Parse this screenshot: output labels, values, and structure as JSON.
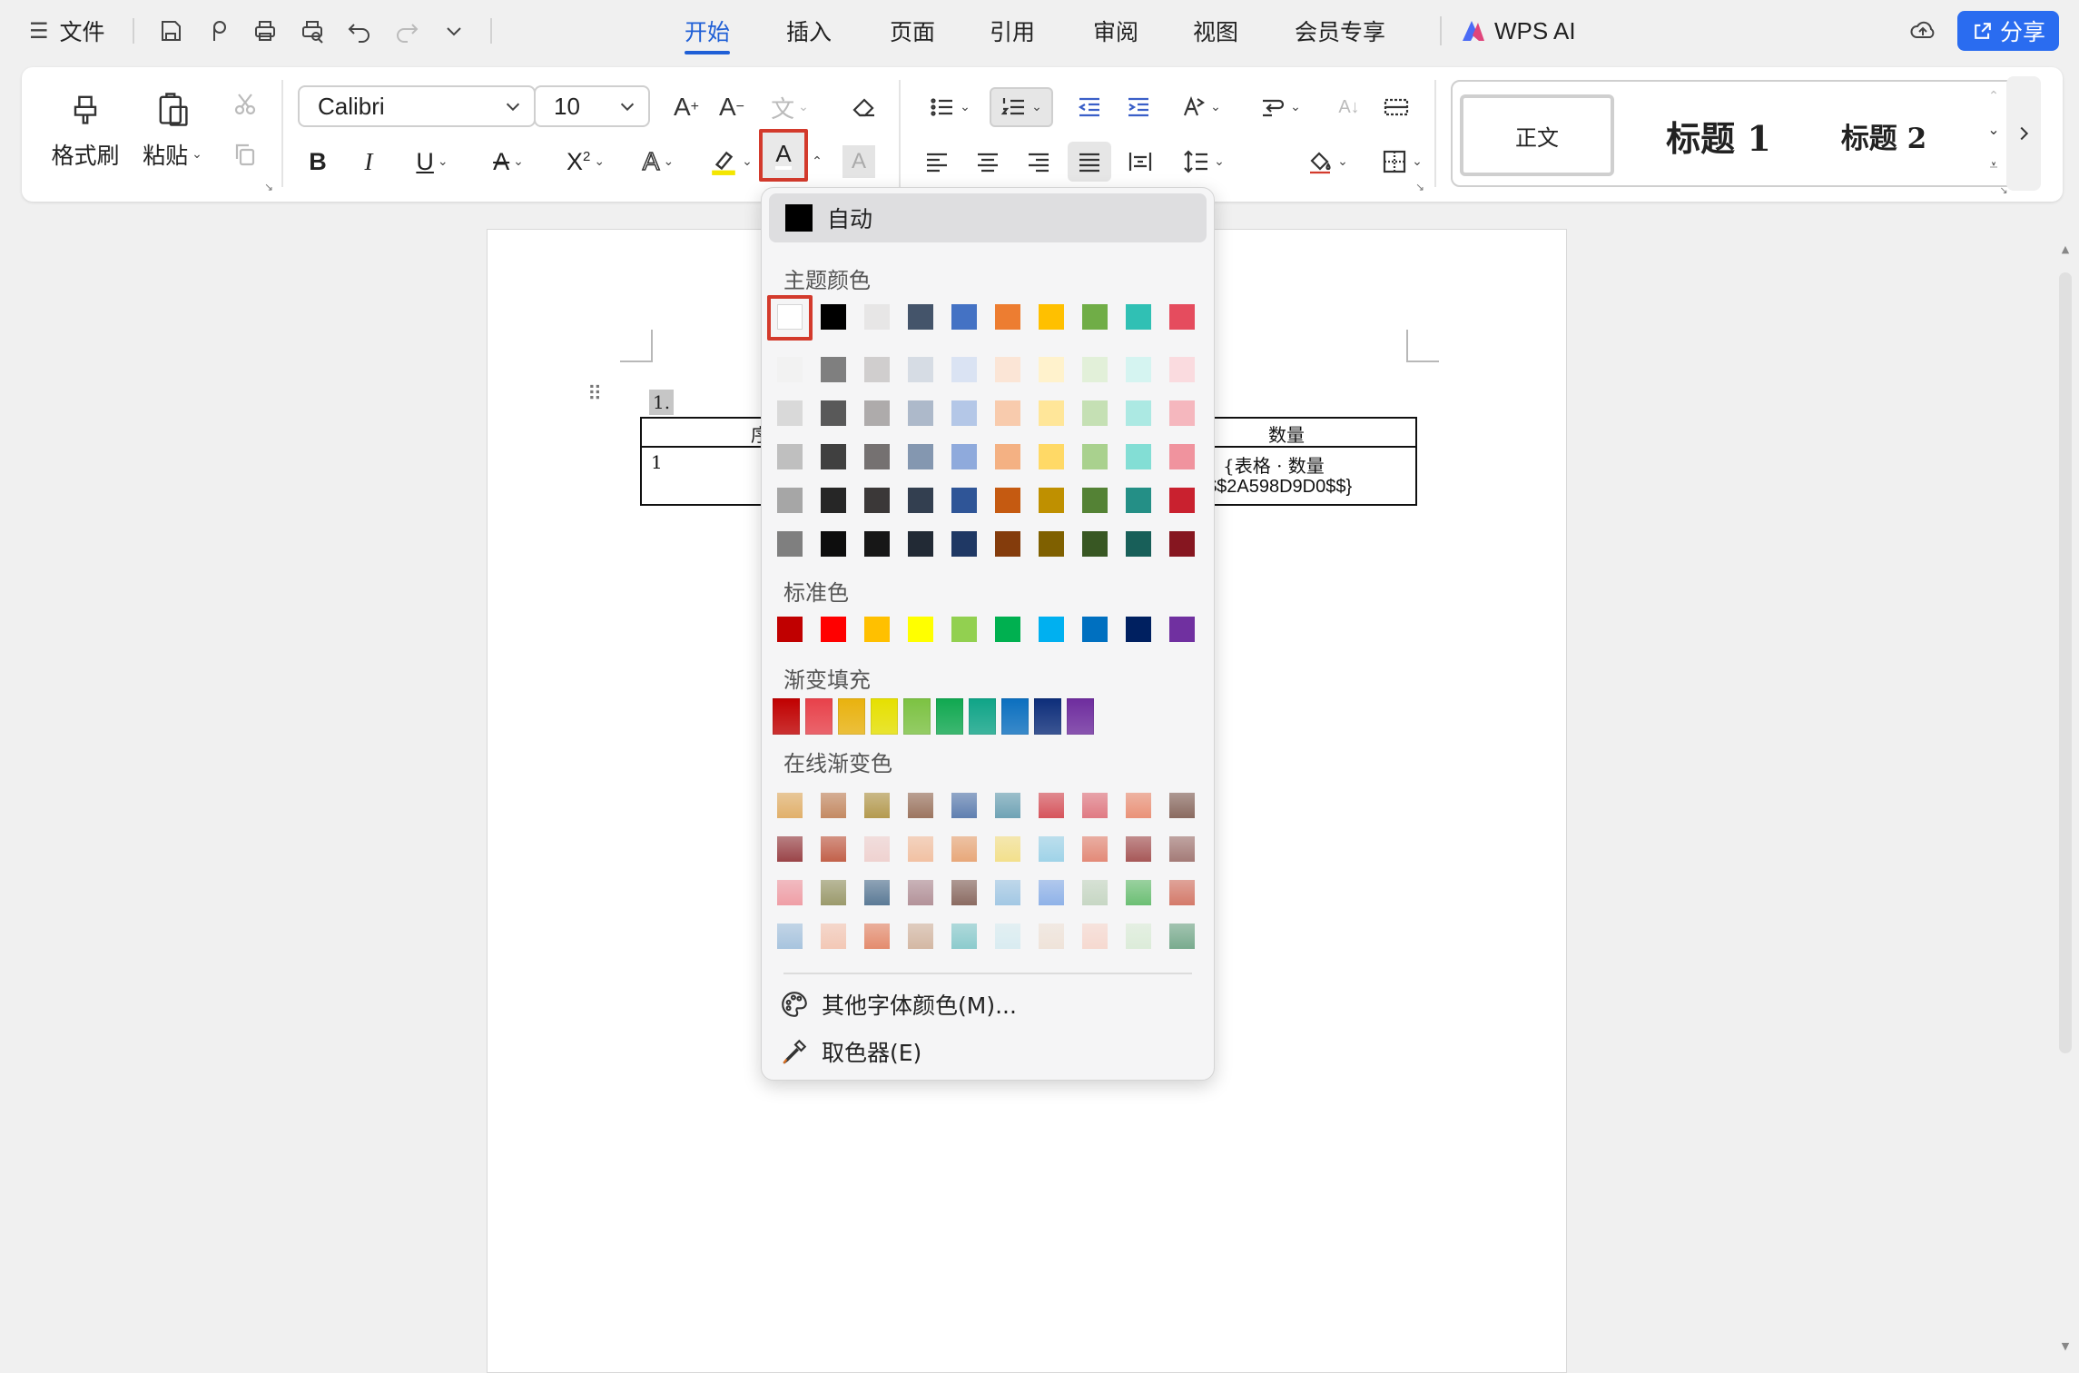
{
  "topbar": {
    "menu_label": "文件",
    "tabs": [
      "开始",
      "插入",
      "页面",
      "引用",
      "审阅",
      "视图",
      "会员专享"
    ],
    "active_tab": "开始",
    "ai_label": "WPS AI",
    "share_label": "分享"
  },
  "ribbon": {
    "format_painter": "格式刷",
    "paste": "粘贴",
    "font_name": "Calibri",
    "font_size": "10",
    "styles": [
      "正文",
      "标题 1",
      "标题 2"
    ]
  },
  "document": {
    "list_number": "1.",
    "header_left": "序",
    "header_right": "数量",
    "cell_left": "1",
    "cell_right_line1": "{表格 · 数量",
    "cell_right_line2": "$$2A598D9D0$$}"
  },
  "color_picker": {
    "auto_label": "自动",
    "theme_title": "主题颜色",
    "theme_top": [
      "#ffffff",
      "#000000",
      "#e7e6e6",
      "#44546a",
      "#4472c4",
      "#ed7d31",
      "#ffc000",
      "#70ad47",
      "#30c0b4",
      "#e54c5e"
    ],
    "theme_shades": [
      [
        "#f2f2f2",
        "#7f7f7f",
        "#d0cece",
        "#d6dce4",
        "#dae3f3",
        "#fbe5d6",
        "#fff2cc",
        "#e2f0d9",
        "#d5f4f1",
        "#fadbdf"
      ],
      [
        "#d9d9d9",
        "#595959",
        "#aeabab",
        "#adb9ca",
        "#b4c7e7",
        "#f8cbad",
        "#ffe699",
        "#c5e0b4",
        "#ace9e3",
        "#f5b7be"
      ],
      [
        "#bfbfbf",
        "#404040",
        "#757171",
        "#8497b0",
        "#8faadc",
        "#f4b183",
        "#ffd966",
        "#a9d18e",
        "#83ded5",
        "#f0939e"
      ],
      [
        "#a6a6a6",
        "#262626",
        "#3b3838",
        "#333f50",
        "#2f5597",
        "#c55a11",
        "#bf9000",
        "#548235",
        "#248f86",
        "#c9212f"
      ],
      [
        "#7f7f7f",
        "#0d0d0d",
        "#171717",
        "#222a35",
        "#1f3864",
        "#843c0c",
        "#7f6000",
        "#385723",
        "#185f59",
        "#861620"
      ]
    ],
    "standard_title": "标准色",
    "standard_colors": [
      "#c00000",
      "#ff0000",
      "#ffc000",
      "#ffff00",
      "#92d050",
      "#00b050",
      "#00b0f0",
      "#0070c0",
      "#002060",
      "#7030a0"
    ],
    "gradient_title": "渐变填充",
    "gradient_colors": [
      "#c00000",
      "#e8414a",
      "#e9b20e",
      "#e6e000",
      "#7cc242",
      "#10a850",
      "#0fa487",
      "#0b6fbf",
      "#0d2d7a",
      "#6e2c9e"
    ],
    "online_title": "在线渐变色",
    "online_rows": [
      [
        "#e1b06a",
        "#c48a63",
        "#b49a4f",
        "#9c7560",
        "#5f7fb0",
        "#6fa3b5",
        "#d6545c",
        "#e07a83",
        "#ea9278",
        "#8a6a60"
      ],
      [
        "#9a4448",
        "#c2614a",
        "#efd2d0",
        "#f2c1a3",
        "#e8a87a",
        "#f3e08c",
        "#9fd3e8",
        "#e38a78",
        "#a75858",
        "#a47b77"
      ],
      [
        "#ef9ea6",
        "#9b9a6c",
        "#5b7a96",
        "#b39299",
        "#8b6b62",
        "#a3c8e4",
        "#8fb2e8",
        "#c7d7c4",
        "#6cbf74",
        "#d47a6a"
      ],
      [
        "#a8c4de",
        "#f3c8b6",
        "#e48c6e",
        "#d4b8a4",
        "#8ccbcd",
        "#d9ecf1",
        "#efe3d9",
        "#f6d9d0",
        "#dcecd9",
        "#79ab8e"
      ]
    ],
    "more_colors": "其他字体颜色(M)...",
    "eyedropper": "取色器(E)"
  }
}
